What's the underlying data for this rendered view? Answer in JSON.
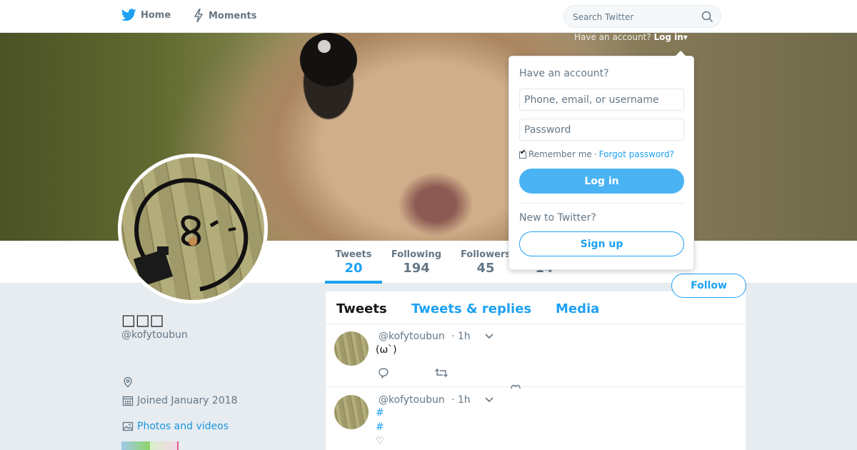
{
  "nav": {
    "home_label": "Home",
    "moments_label": "Moments",
    "search_placeholder": "Search Twitter",
    "icons": {
      "home": "twitter-bird-icon",
      "moments": "lightning-icon",
      "search": "search-icon"
    }
  },
  "login_hint": {
    "text": "Have an account?",
    "link": "Log in",
    "caret": "▾"
  },
  "login_dropdown": {
    "title": "Have an account?",
    "username_placeholder": "Phone, email, or username",
    "password_placeholder": "Password",
    "remember_label": "Remember me",
    "separator": "·",
    "forgot_label": "Forgot password?",
    "login_button": "Log in",
    "new_label": "New to Twitter?",
    "signup_button": "Sign up"
  },
  "stats": {
    "tweets": {
      "label": "Tweets",
      "value": "20"
    },
    "following": {
      "label": "Following",
      "value": "194"
    },
    "followers": {
      "label": "Followers",
      "value": "45"
    },
    "likes": {
      "value": "14"
    }
  },
  "follow_button": "Follow",
  "profile": {
    "name": "□□□",
    "handle": "@kofytoubun",
    "joined": "Joined January 2018",
    "photos_link": "Photos and videos"
  },
  "timeline": {
    "tabs": [
      "Tweets",
      "Tweets & replies",
      "Media"
    ],
    "tweets": [
      {
        "handle": "@kofytoubun",
        "time": "· 1h",
        "text": "(ω`)"
      },
      {
        "handle": "@kofytoubun",
        "time": "· 1h",
        "tag1": "#",
        "tag2": "#",
        "heart": "♡"
      }
    ]
  },
  "colors": {
    "accent": "#1da1f2",
    "background": "#e6ecf0",
    "muted": "#657786"
  }
}
